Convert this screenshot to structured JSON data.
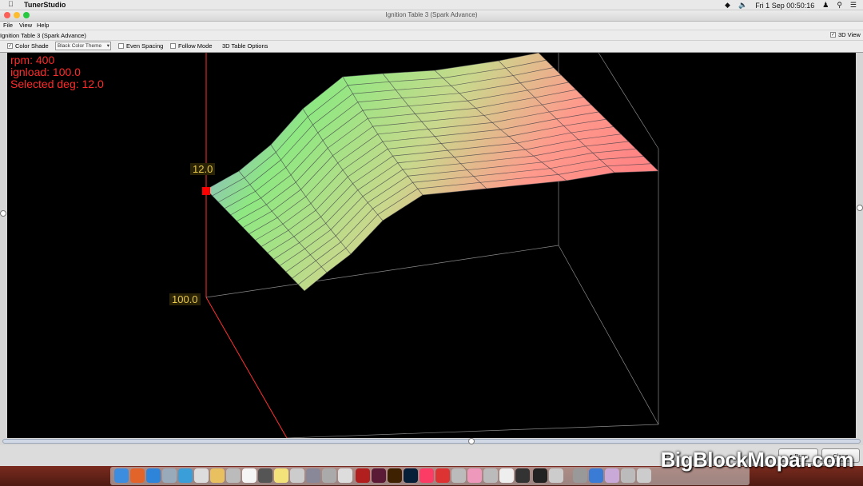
{
  "menubar": {
    "app_name": "TunerStudio",
    "clock": "Fri 1 Sep  00:50:16"
  },
  "window": {
    "title": "Ignition Table 3 (Spark Advance)"
  },
  "menu": {
    "file": "File",
    "view": "View",
    "help": "Help"
  },
  "panel": {
    "title": "Ignition Table 3 (Spark Advance)",
    "view3d_label": "3D View",
    "view3d_checked": true
  },
  "toolbar": {
    "color_shade_label": "Color Shade",
    "color_shade_checked": true,
    "theme_value": "Black Color Theme",
    "even_spacing_label": "Even Spacing",
    "follow_mode_label": "Follow Mode",
    "table_options_label": "3D Table Options"
  },
  "readout": {
    "rpm": "rpm: 400",
    "load": "ignload: 100.0",
    "selected": "Selected deg: 12.0"
  },
  "axis_labels": {
    "z_value": "12.0",
    "load_value": "100.0"
  },
  "buttons": {
    "burn": "Burn",
    "close": "Close"
  },
  "watermark": "BigBlockMopar.com",
  "colors": {
    "low": "#8a8cff",
    "mid": "#8ee882",
    "high": "#ff8a8a",
    "readout": "#ff2a2a",
    "selected_point": "#ff0000"
  }
}
